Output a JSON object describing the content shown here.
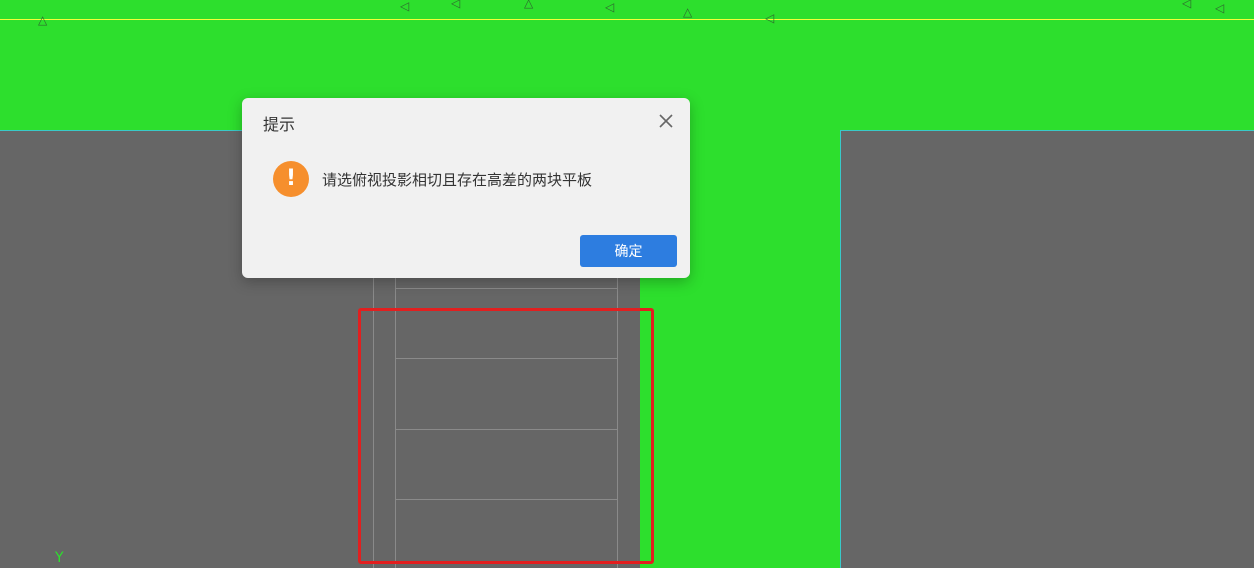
{
  "dialog": {
    "title": "提示",
    "message": "请选俯视投影相切且存在高差的两块平板",
    "ok_label": "确定",
    "close_icon": "close-icon",
    "status_icon": "warning-icon",
    "status_icon_glyph": "!"
  },
  "canvas": {
    "axis_label": "Y"
  },
  "colors": {
    "floor_slab": "#2ddf2d",
    "wall_slab": "#666666",
    "highlight": "#e21f1f",
    "warning": "#f68f2d",
    "primary": "#2d7de0"
  }
}
